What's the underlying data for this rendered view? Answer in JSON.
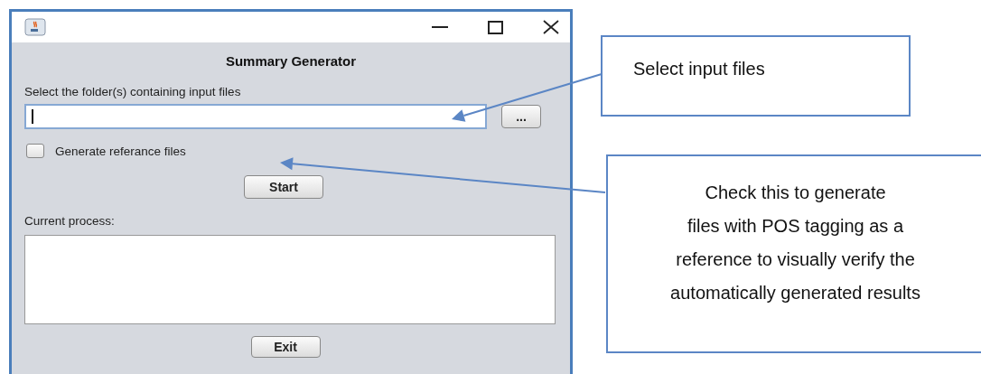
{
  "window": {
    "heading": "Summary Generator",
    "folder_label": "Select the folder(s) containing input files",
    "folder_field": {
      "focused": true
    },
    "browse_button": "...",
    "reference_checkbox": {
      "label": "Generate referance files",
      "checked": false
    },
    "start_button": "Start",
    "process_label": "Current process:",
    "exit_button": "Exit"
  },
  "callouts": [
    {
      "lines": [
        "Select input files"
      ]
    },
    {
      "lines": [
        "Check this to generate",
        "files with POS tagging as a",
        "reference to visually verify the",
        "automatically generated results"
      ]
    }
  ]
}
